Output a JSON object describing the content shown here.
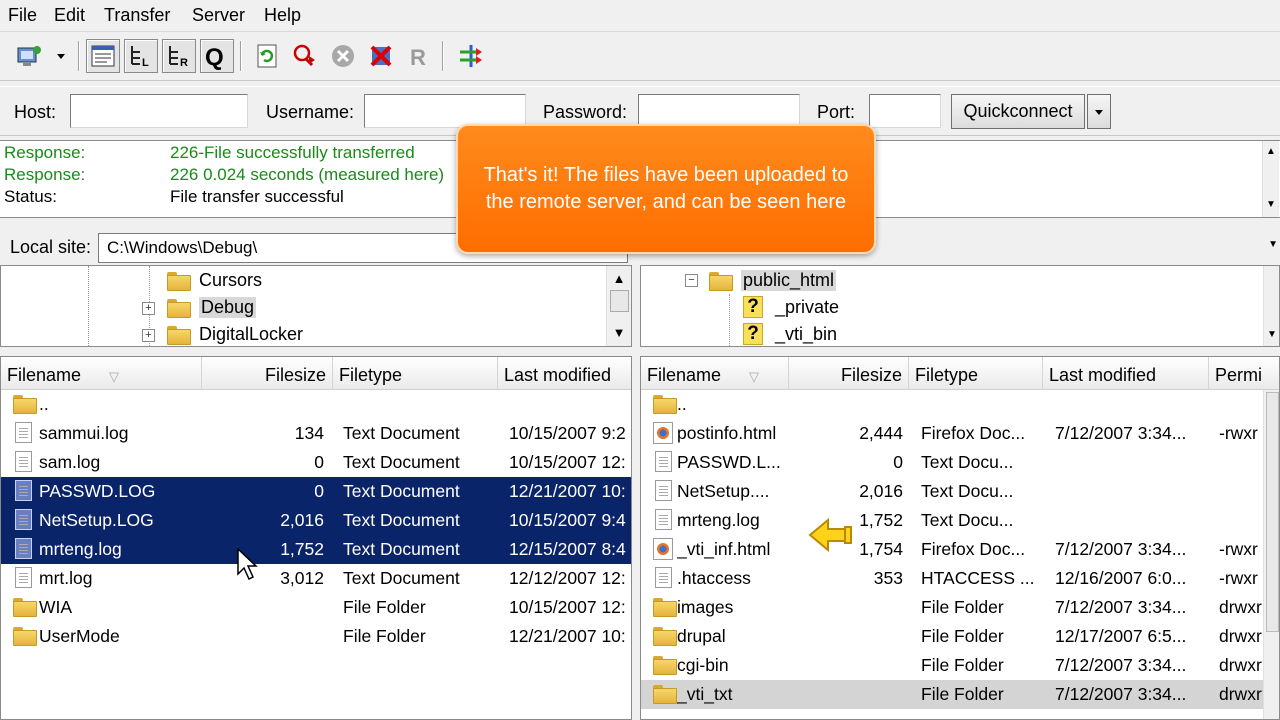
{
  "menu": [
    "File",
    "Edit",
    "Transfer",
    "Server",
    "Help"
  ],
  "toolbar": {
    "buttons": [
      "site-manager-icon",
      "dropdown-arrow-icon",
      "message-log-icon",
      "local-tree-icon",
      "remote-tree-icon",
      "queue-icon",
      "refresh-icon",
      "process-queue-icon",
      "cancel-icon",
      "disconnect-icon",
      "reconnect-icon",
      "compare-icon"
    ]
  },
  "quickconnect": {
    "host_label": "Host:",
    "username_label": "Username:",
    "password_label": "Password:",
    "port_label": "Port:",
    "button": "Quickconnect",
    "host_value": "",
    "username_value": "",
    "password_value": "",
    "port_value": ""
  },
  "log": [
    {
      "key": "Response:",
      "value": "226-File successfully transferred",
      "color": "#1a8a1a"
    },
    {
      "key": "Response:",
      "value": "226 0.024 seconds (measured here)",
      "color": "#1a8a1a"
    },
    {
      "key": "Status:",
      "value": "File transfer successful",
      "color": "#000000"
    }
  ],
  "callout": {
    "text": "That's it! The files have been uploaded to the remote server, and can be seen here"
  },
  "local": {
    "site_label": "Local site:",
    "path": "C:\\Windows\\Debug\\",
    "tree": [
      "Cursors",
      "Debug",
      "DigitalLocker"
    ],
    "headers": {
      "name": "Filename",
      "size": "Filesize",
      "type": "Filetype",
      "modified": "Last modified"
    },
    "files": [
      {
        "name": "..",
        "size": "",
        "type": "",
        "modified": "",
        "icon": "folder",
        "selected": false
      },
      {
        "name": "sammui.log",
        "size": "134",
        "type": "Text Document",
        "modified": "10/15/2007 9:2",
        "icon": "doc",
        "selected": false
      },
      {
        "name": "sam.log",
        "size": "0",
        "type": "Text Document",
        "modified": "10/15/2007 12:",
        "icon": "doc",
        "selected": false
      },
      {
        "name": "PASSWD.LOG",
        "size": "0",
        "type": "Text Document",
        "modified": "12/21/2007 10:",
        "icon": "doc",
        "selected": true
      },
      {
        "name": "NetSetup.LOG",
        "size": "2,016",
        "type": "Text Document",
        "modified": "10/15/2007 9:4",
        "icon": "doc",
        "selected": true
      },
      {
        "name": "mrteng.log",
        "size": "1,752",
        "type": "Text Document",
        "modified": "12/15/2007 8:4",
        "icon": "doc",
        "selected": true
      },
      {
        "name": "mrt.log",
        "size": "3,012",
        "type": "Text Document",
        "modified": "12/12/2007 12:",
        "icon": "doc",
        "selected": false
      },
      {
        "name": "WIA",
        "size": "",
        "type": "File Folder",
        "modified": "10/15/2007 12:",
        "icon": "folder",
        "selected": false
      },
      {
        "name": "UserMode",
        "size": "",
        "type": "File Folder",
        "modified": "12/21/2007 10:",
        "icon": "folder",
        "selected": false
      }
    ]
  },
  "remote": {
    "tree": [
      {
        "name": "public_html",
        "icon": "folder"
      },
      {
        "name": "_private",
        "icon": "question"
      },
      {
        "name": "_vti_bin",
        "icon": "question"
      }
    ],
    "headers": {
      "name": "Filename",
      "size": "Filesize",
      "type": "Filetype",
      "modified": "Last modified",
      "perm": "Permi"
    },
    "files": [
      {
        "name": "..",
        "size": "",
        "type": "",
        "modified": "",
        "perm": "",
        "icon": "folder"
      },
      {
        "name": "postinfo.html",
        "size": "2,444",
        "type": "Firefox Doc...",
        "modified": "7/12/2007 3:34...",
        "perm": "-rwxr",
        "icon": "ff"
      },
      {
        "name": "PASSWD.L...",
        "size": "0",
        "type": "Text Docu...",
        "modified": "",
        "perm": "",
        "icon": "doc"
      },
      {
        "name": "NetSetup....",
        "size": "2,016",
        "type": "Text Docu...",
        "modified": "",
        "perm": "",
        "icon": "doc"
      },
      {
        "name": "mrteng.log",
        "size": "1,752",
        "type": "Text Docu...",
        "modified": "",
        "perm": "",
        "icon": "doc"
      },
      {
        "name": "_vti_inf.html",
        "size": "1,754",
        "type": "Firefox Doc...",
        "modified": "7/12/2007 3:34...",
        "perm": "-rwxr",
        "icon": "ff"
      },
      {
        "name": ".htaccess",
        "size": "353",
        "type": "HTACCESS ...",
        "modified": "12/16/2007 6:0...",
        "perm": "-rwxr",
        "icon": "doc"
      },
      {
        "name": "images",
        "size": "",
        "type": "File Folder",
        "modified": "7/12/2007 3:34...",
        "perm": "drwxr",
        "icon": "folder"
      },
      {
        "name": "drupal",
        "size": "",
        "type": "File Folder",
        "modified": "12/17/2007 6:5...",
        "perm": "drwxr",
        "icon": "folder"
      },
      {
        "name": "cgi-bin",
        "size": "",
        "type": "File Folder",
        "modified": "7/12/2007 3:34...",
        "perm": "drwxr",
        "icon": "folder"
      },
      {
        "name": "_vti_txt",
        "size": "",
        "type": "File Folder",
        "modified": "7/12/2007 3:34...",
        "perm": "drwxr",
        "icon": "folder"
      }
    ]
  }
}
